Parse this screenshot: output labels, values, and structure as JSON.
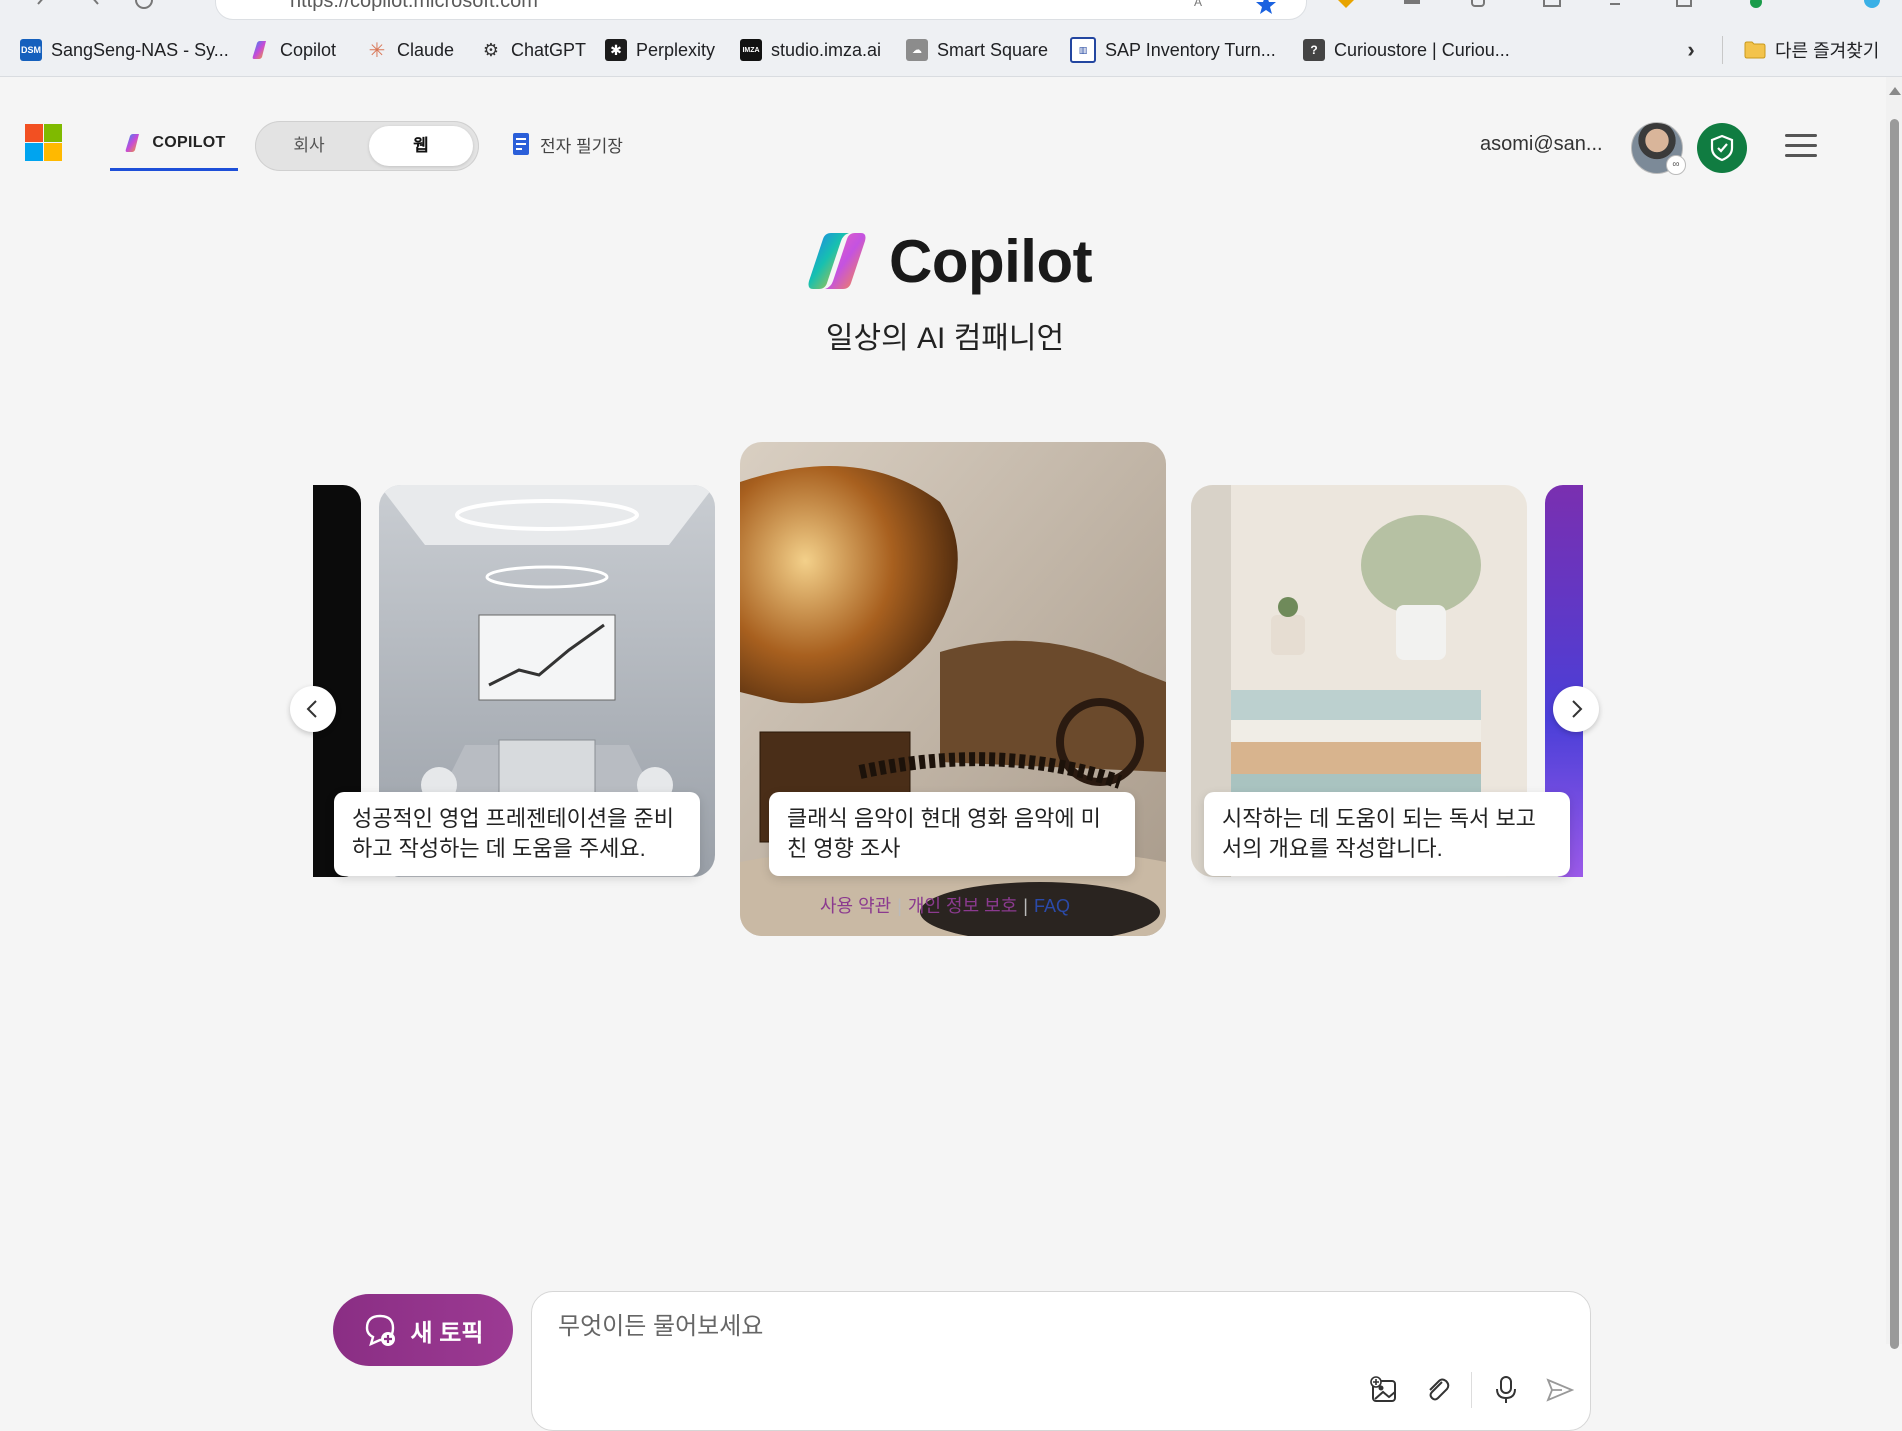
{
  "browser": {
    "url": "https://copilot.microsoft.com",
    "bookmarks": [
      {
        "label": "SangSeng-NAS - Sy...",
        "icon": "dsm-icon"
      },
      {
        "label": "Copilot",
        "icon": "copilot-icon"
      },
      {
        "label": "Claude",
        "icon": "claude-icon"
      },
      {
        "label": "ChatGPT",
        "icon": "chatgpt-icon"
      },
      {
        "label": "Perplexity",
        "icon": "perplexity-icon"
      },
      {
        "label": "studio.imza.ai",
        "icon": "imza-icon"
      },
      {
        "label": "Smart Square",
        "icon": "cloud-icon"
      },
      {
        "label": "SAP Inventory Turn...",
        "icon": "sap-icon"
      },
      {
        "label": "Curioustore | Curiou...",
        "icon": "curioustore-icon"
      }
    ],
    "other_favorites": "다른 즐겨찾기"
  },
  "header": {
    "tab_copilot": "COPILOT",
    "toggle": {
      "company": "회사",
      "web": "웹",
      "selected": "web"
    },
    "notebook": "전자 필기장",
    "user_email": "asomi@san..."
  },
  "hero": {
    "title": "Copilot",
    "tagline": "일상의 AI 컴패니언"
  },
  "carousel": {
    "cards": [
      {
        "caption": "성공적인 영업 프레젠테이션을 준비하고 작성하는 데 도움을 주세요."
      },
      {
        "caption": "클래식 음악이 현대 영화 음악에 미친 영향 조사"
      },
      {
        "caption": "시작하는 데 도움이 되는 독서 보고서의 개요를 작성합니다."
      }
    ]
  },
  "footer": {
    "terms": "사용 약관",
    "privacy": "개인 정보 보호",
    "faq": "FAQ"
  },
  "composer": {
    "new_topic": "새 토픽",
    "placeholder": "무엇이든 물어보세요"
  },
  "colors": {
    "accent_blue": "#1d4fd8",
    "new_topic_purple": "#8a2e84",
    "link_purple": "#8b3a8f",
    "shield_green": "#107c41"
  }
}
